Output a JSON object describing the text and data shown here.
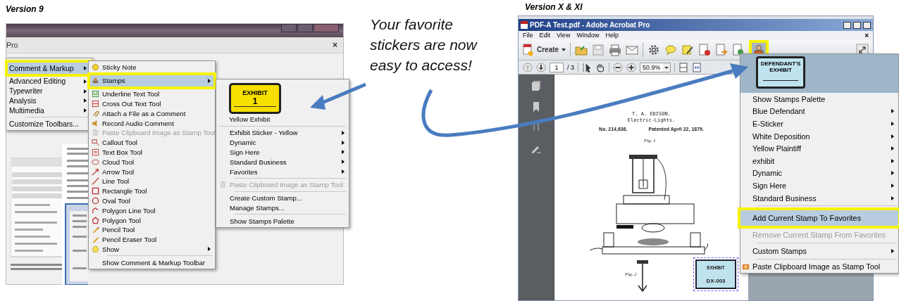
{
  "left_heading": "Version 9",
  "left_window": {
    "app_title": "Pro",
    "close_glyph": "×",
    "main_menu": [
      [
        {
          "label": "Comment & Markup",
          "selected": true,
          "disabled": false,
          "has_submenu": true
        },
        {
          "label": "Advanced Editing",
          "selected": false,
          "disabled": false,
          "has_submenu": true
        },
        {
          "label": "Typewriter",
          "selected": false,
          "disabled": false,
          "has_submenu": true
        },
        {
          "label": "Analysis",
          "selected": false,
          "disabled": false,
          "has_submenu": true
        },
        {
          "label": "Multimedia",
          "selected": false,
          "disabled": false,
          "has_submenu": true
        }
      ],
      [
        {
          "label": "Customize Toolbars...",
          "selected": false,
          "disabled": false,
          "has_submenu": false
        }
      ]
    ],
    "comment_menu": [
      [
        {
          "label": "Sticky Note",
          "selected": false,
          "disabled": false,
          "has_submenu": false
        },
        {
          "label": "Stamps",
          "selected": true,
          "disabled": false,
          "has_submenu": true
        },
        {
          "label": "Underline Text Tool",
          "selected": false,
          "disabled": false,
          "has_submenu": false
        },
        {
          "label": "Cross Out Text Tool",
          "selected": false,
          "disabled": false,
          "has_submenu": false
        },
        {
          "label": "Attach a File as a Comment",
          "selected": false,
          "disabled": false,
          "has_submenu": false
        },
        {
          "label": "Record Audio Comment",
          "selected": false,
          "disabled": false,
          "has_submenu": false
        },
        {
          "label": "Paste Clipboard Image as Stamp Tool",
          "selected": false,
          "disabled": true,
          "has_submenu": false
        },
        {
          "label": "Callout Tool",
          "selected": false,
          "disabled": false,
          "has_submenu": false
        },
        {
          "label": "Text Box Tool",
          "selected": false,
          "disabled": false,
          "has_submenu": false
        },
        {
          "label": "Cloud Tool",
          "selected": false,
          "disabled": false,
          "has_submenu": false
        },
        {
          "label": "Arrow Tool",
          "selected": false,
          "disabled": false,
          "has_submenu": false
        },
        {
          "label": "Line Tool",
          "selected": false,
          "disabled": false,
          "has_submenu": false
        },
        {
          "label": "Rectangle Tool",
          "selected": false,
          "disabled": false,
          "has_submenu": false
        },
        {
          "label": "Oval Tool",
          "selected": false,
          "disabled": false,
          "has_submenu": false
        },
        {
          "label": "Polygon Line Tool",
          "selected": false,
          "disabled": false,
          "has_submenu": false
        },
        {
          "label": "Polygon Tool",
          "selected": false,
          "disabled": false,
          "has_submenu": false
        },
        {
          "label": "Pencil Tool",
          "selected": false,
          "disabled": false,
          "has_submenu": false
        },
        {
          "label": "Pencil Eraser Tool",
          "selected": false,
          "disabled": false,
          "has_submenu": false
        },
        {
          "label": "Show",
          "selected": false,
          "disabled": false,
          "has_submenu": true
        }
      ],
      [
        {
          "label": "Show Comment & Markup Toolbar",
          "selected": false,
          "disabled": false,
          "has_submenu": false
        }
      ]
    ],
    "stamps_menu": {
      "stamp": {
        "title": "EXHIBIT",
        "number": "1",
        "caption": "Yellow Exhibit"
      },
      "sections": [
        [
          {
            "label": "Exhibit Sticker - Yellow",
            "selected": false,
            "disabled": false,
            "has_submenu": true
          },
          {
            "label": "Dynamic",
            "selected": false,
            "disabled": false,
            "has_submenu": true
          },
          {
            "label": "Sign Here",
            "selected": false,
            "disabled": false,
            "has_submenu": true
          },
          {
            "label": "Standard Business",
            "selected": false,
            "disabled": false,
            "has_submenu": true
          },
          {
            "label": "Favorites",
            "selected": false,
            "disabled": false,
            "has_submenu": true
          }
        ],
        [
          {
            "label": "Paste Clipboard Image as Stamp Tool",
            "selected": false,
            "disabled": true,
            "has_submenu": false
          }
        ],
        [
          {
            "label": "Create Custom Stamp...",
            "selected": false,
            "disabled": false,
            "has_submenu": false
          },
          {
            "label": "Manage Stamps...",
            "selected": false,
            "disabled": false,
            "has_submenu": false
          }
        ],
        [
          {
            "label": "Show Stamps Palette",
            "selected": false,
            "disabled": false,
            "has_submenu": false
          }
        ]
      ]
    }
  },
  "callout": "Your favorite stickers are now easy to access!",
  "right_heading": "Version X & XI",
  "right_window": {
    "title": "PDF-A Test.pdf - Adobe Acrobat Pro",
    "close_glyph": "×",
    "menus": [
      "File",
      "Edit",
      "View",
      "Window",
      "Help"
    ],
    "create_button": "Create",
    "stamp_button": {
      "selected": true
    },
    "page": "1",
    "page_total": "/ 3",
    "zoom": "50.9%",
    "document": {
      "lines": [
        "T. A. EDISON.",
        "Electric-Lights."
      ],
      "number": "No. 214,636.",
      "date": "Patented April 22, 1879.",
      "figures": [
        "Fig. 1",
        "Fig. 2"
      ],
      "stamp": {
        "title": "EXHIBIT",
        "number": "DX-003"
      }
    },
    "stamp_menu": {
      "stamp": {
        "line1": "DEFENDANT'S",
        "line2": "EXHIBIT"
      },
      "sections": [
        [
          {
            "label": "Show Stamps Palette",
            "selected": false,
            "disabled": false,
            "has_submenu": false
          },
          {
            "label": "Blue Defendant",
            "selected": false,
            "disabled": false,
            "has_submenu": true
          },
          {
            "label": "E-Sticker",
            "selected": false,
            "disabled": false,
            "has_submenu": true
          },
          {
            "label": "White Deposition",
            "selected": false,
            "disabled": false,
            "has_submenu": true
          },
          {
            "label": "Yellow Plaintiff",
            "selected": false,
            "disabled": false,
            "has_submenu": true
          },
          {
            "label": "exhibit",
            "selected": false,
            "disabled": false,
            "has_submenu": true
          },
          {
            "label": "Dynamic",
            "selected": false,
            "disabled": false,
            "has_submenu": true
          },
          {
            "label": "Sign Here",
            "selected": false,
            "disabled": false,
            "has_submenu": true
          },
          {
            "label": "Standard Business",
            "selected": false,
            "disabled": false,
            "has_submenu": true
          }
        ],
        [
          {
            "label": "Add Current Stamp To Favorites",
            "selected": true,
            "disabled": false,
            "has_submenu": false
          },
          {
            "label": "Remove Current Stamp From Favorites",
            "selected": false,
            "disabled": true,
            "has_submenu": false
          }
        ],
        [
          {
            "label": "Custom Stamps",
            "selected": false,
            "disabled": false,
            "has_submenu": true
          }
        ],
        [
          {
            "label": "Paste Clipboard Image as Stamp Tool",
            "selected": false,
            "disabled": false,
            "has_submenu": false
          }
        ]
      ]
    }
  }
}
